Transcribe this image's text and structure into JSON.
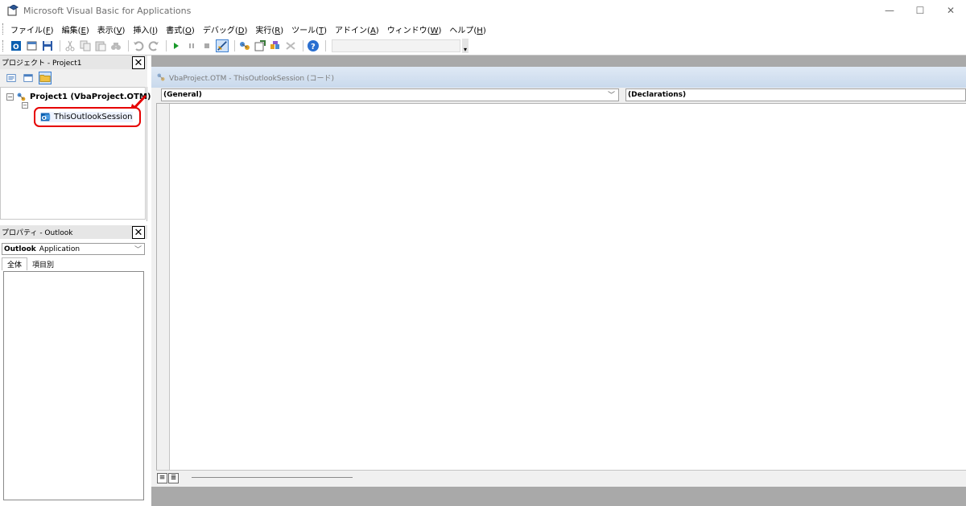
{
  "window": {
    "title": "Microsoft Visual Basic for Applications",
    "controls": {
      "minimize": "—",
      "maximize": "☐",
      "close": "✕"
    }
  },
  "menu": [
    {
      "label": "ファイル",
      "key": "F"
    },
    {
      "label": "編集",
      "key": "E"
    },
    {
      "label": "表示",
      "key": "V"
    },
    {
      "label": "挿入",
      "key": "I"
    },
    {
      "label": "書式",
      "key": "O"
    },
    {
      "label": "デバッグ",
      "key": "D"
    },
    {
      "label": "実行",
      "key": "R"
    },
    {
      "label": "ツール",
      "key": "T"
    },
    {
      "label": "アドイン",
      "key": "A"
    },
    {
      "label": "ウィンドウ",
      "key": "W"
    },
    {
      "label": "ヘルプ",
      "key": "H"
    }
  ],
  "toolbar": {
    "icons": [
      "view-outlook-icon",
      "insert-module-icon",
      "save-icon",
      "cut-icon",
      "copy-icon",
      "paste-icon",
      "find-icon",
      "undo-icon",
      "redo-icon",
      "run-icon",
      "break-icon",
      "reset-icon",
      "design-mode-icon",
      "project-explorer-icon",
      "properties-window-icon",
      "object-browser-icon",
      "toolbox-icon",
      "help-icon"
    ]
  },
  "project_explorer": {
    "title": "プロジェクト - Project1",
    "close_label": "✕",
    "root_label": "Project1 (VbaProject.OTM)",
    "expander_root": "−",
    "expander_child": "−",
    "selected_item": "ThisOutlookSession"
  },
  "properties": {
    "title": "プロパティ - Outlook",
    "close_label": "✕",
    "object_name": "Outlook",
    "object_type": "Application",
    "tabs": [
      "全体",
      "項目別"
    ]
  },
  "code_window": {
    "title": "VbaProject.OTM - ThisOutlookSession (コード)",
    "object_combo": "(General)",
    "proc_combo": "(Declarations)",
    "combo_arrow": "﹀",
    "view_procedure": "≡",
    "view_module": "≣"
  },
  "colors": {
    "highlight_red": "#e60000",
    "title_gradient_top": "#dfe9f5",
    "mdi_background": "#a9a9a9"
  }
}
